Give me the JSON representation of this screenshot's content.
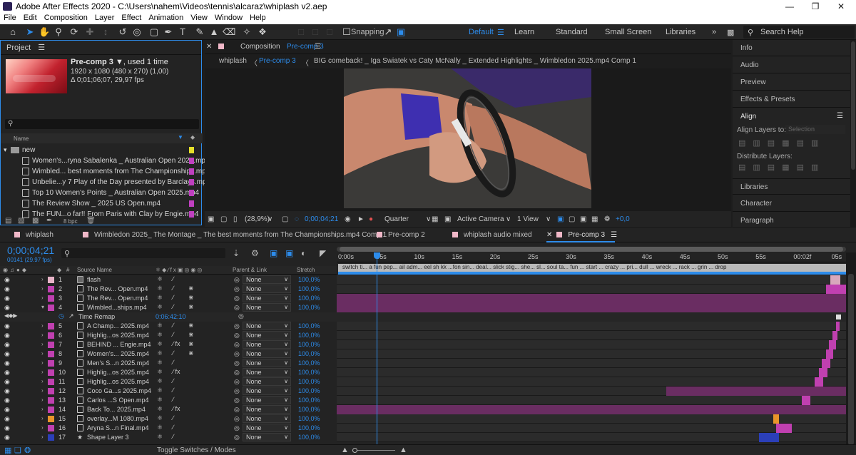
{
  "window": {
    "title": "Adobe After Effects 2020 - C:\\Users\\nahem\\Videos\\tennis\\alcaraz\\whiplash v2.aep"
  },
  "menu": [
    "File",
    "Edit",
    "Composition",
    "Layer",
    "Effect",
    "Animation",
    "View",
    "Window",
    "Help"
  ],
  "toolbar": {
    "snapping": "Snapping",
    "workspaces": [
      "Default",
      "Learn",
      "Standard",
      "Small Screen",
      "Libraries"
    ],
    "search_help": "Search Help"
  },
  "project": {
    "panel_title": "Project",
    "item_name": "Pre-comp 3",
    "used": ", used 1 time",
    "dims": "1920 x 1080  (480 x 270) (1,00)",
    "duration": "Δ 0;01;06;07, 29,97 fps",
    "col_name": "Name",
    "folder": "new",
    "bpc": "8 bpc",
    "items": [
      "Women's...ryna Sabalenka _ Australian Open 2025.mp4",
      "Wimbled... best moments from The Championships.mp4",
      "Unbelie...y 7 Play of the Day presented by Barclays.mp4",
      "Top 10 Women's Points _ Australian Open 2025.mp4",
      "The Review Show _ 2025 US Open.mp4",
      "The FUN...o far!! From Paris with Clay by Engie.mp4"
    ]
  },
  "composition": {
    "label": "Composition",
    "name": "Pre-comp 3",
    "breadcrumbs": [
      "whiplash",
      "Pre-comp 3",
      "BIG comeback! _ Iga Swiatek vs Caty McNally _ Extended Highlights _ Wimbledon 2025.mp4 Comp 1"
    ],
    "zoom": "(28,9%)",
    "timecode": "0;00;04;21",
    "resolution": "Quarter",
    "camera": "Active Camera",
    "views": "1 View",
    "exposure": "+0,0"
  },
  "right_panels": [
    "Info",
    "Audio",
    "Preview",
    "Effects & Presets",
    "Align",
    "Libraries",
    "Character",
    "Paragraph"
  ],
  "align": {
    "align_to_label": "Align Layers to:",
    "align_to_value": "Selection",
    "distribute": "Distribute Layers:"
  },
  "timeline_tabs": [
    "whiplash",
    "Wimbledon 2025_ The Montage _ The best moments from The Championships.mp4 Comp 1",
    "Pre-comp 2",
    "whiplash audio mixed",
    "Pre-comp 3"
  ],
  "timeline": {
    "timecode": "0;00;04;21",
    "frame_info": "00141 (29.97 fps)",
    "col_source": "Source Name",
    "col_parent": "Parent & Link",
    "col_stretch": "Stretch",
    "ruler": [
      "0:00s",
      "05s",
      "10s",
      "15s",
      "20s",
      "25s",
      "30s",
      "35s",
      "40s",
      "45s",
      "50s",
      "55s",
      "00:02f",
      "05s"
    ],
    "toggle": "Toggle Switches / Modes",
    "time_remap": "Time Remap",
    "time_remap_value": "0:06:42:10",
    "layers": [
      {
        "n": "1",
        "name": "flash",
        "color": "#e8b4c8",
        "fx": false
      },
      {
        "n": "2",
        "name": "The Rev... Open.mp4",
        "color": "#c040b0",
        "fx": false
      },
      {
        "n": "3",
        "name": "The Rev... Open.mp4",
        "color": "#c040b0",
        "fx": false
      },
      {
        "n": "4",
        "name": "Wimbled...ships.mp4",
        "color": "#c040b0",
        "fx": false
      },
      {
        "n": "5",
        "name": "A Champ... 2025.mp4",
        "color": "#c040b0",
        "fx": false
      },
      {
        "n": "6",
        "name": "Highlig...os 2025.mp4",
        "color": "#c040b0",
        "fx": false
      },
      {
        "n": "7",
        "name": "BEHIND ... Engie.mp4",
        "color": "#c040b0",
        "fx": true
      },
      {
        "n": "8",
        "name": "Women's... 2025.mp4",
        "color": "#c040b0",
        "fx": false
      },
      {
        "n": "9",
        "name": "Men's S...n 2025.mp4",
        "color": "#c040b0",
        "fx": false
      },
      {
        "n": "10",
        "name": "Highlig...os 2025.mp4",
        "color": "#c040b0",
        "fx": true
      },
      {
        "n": "11",
        "name": "Highlig...os 2025.mp4",
        "color": "#c040b0",
        "fx": false
      },
      {
        "n": "12",
        "name": "Coco Ga...s 2025.mp4",
        "color": "#c040b0",
        "fx": false
      },
      {
        "n": "13",
        "name": "Carlos ...S Open.mp4",
        "color": "#c040b0",
        "fx": false
      },
      {
        "n": "14",
        "name": "Back To... 2025.mp4",
        "color": "#c040b0",
        "fx": true
      },
      {
        "n": "15",
        "name": "overlay...M 1080.mp4",
        "color": "#e8952a",
        "fx": false
      },
      {
        "n": "16",
        "name": "Aryna S...n Final.mp4",
        "color": "#c040b0",
        "fx": false
      },
      {
        "n": "17",
        "name": "Shape Layer 3",
        "color": "#2b3fb8",
        "fx": false
      }
    ],
    "parent": "None",
    "stretch": "100,0%",
    "marker_text": "switch ti... a fun pep... ail adm... eel sh kk ...fon sin... deal... slick stig... she... sl... soul ta... fun ... start ... crazy ... pri... dull ... wreck ... rack ... grin ... drop"
  },
  "colors": {
    "accent": "#2d8ceb",
    "label_pink": "#c040b0",
    "label_orange": "#e8952a",
    "label_blue": "#2b3fb8"
  }
}
